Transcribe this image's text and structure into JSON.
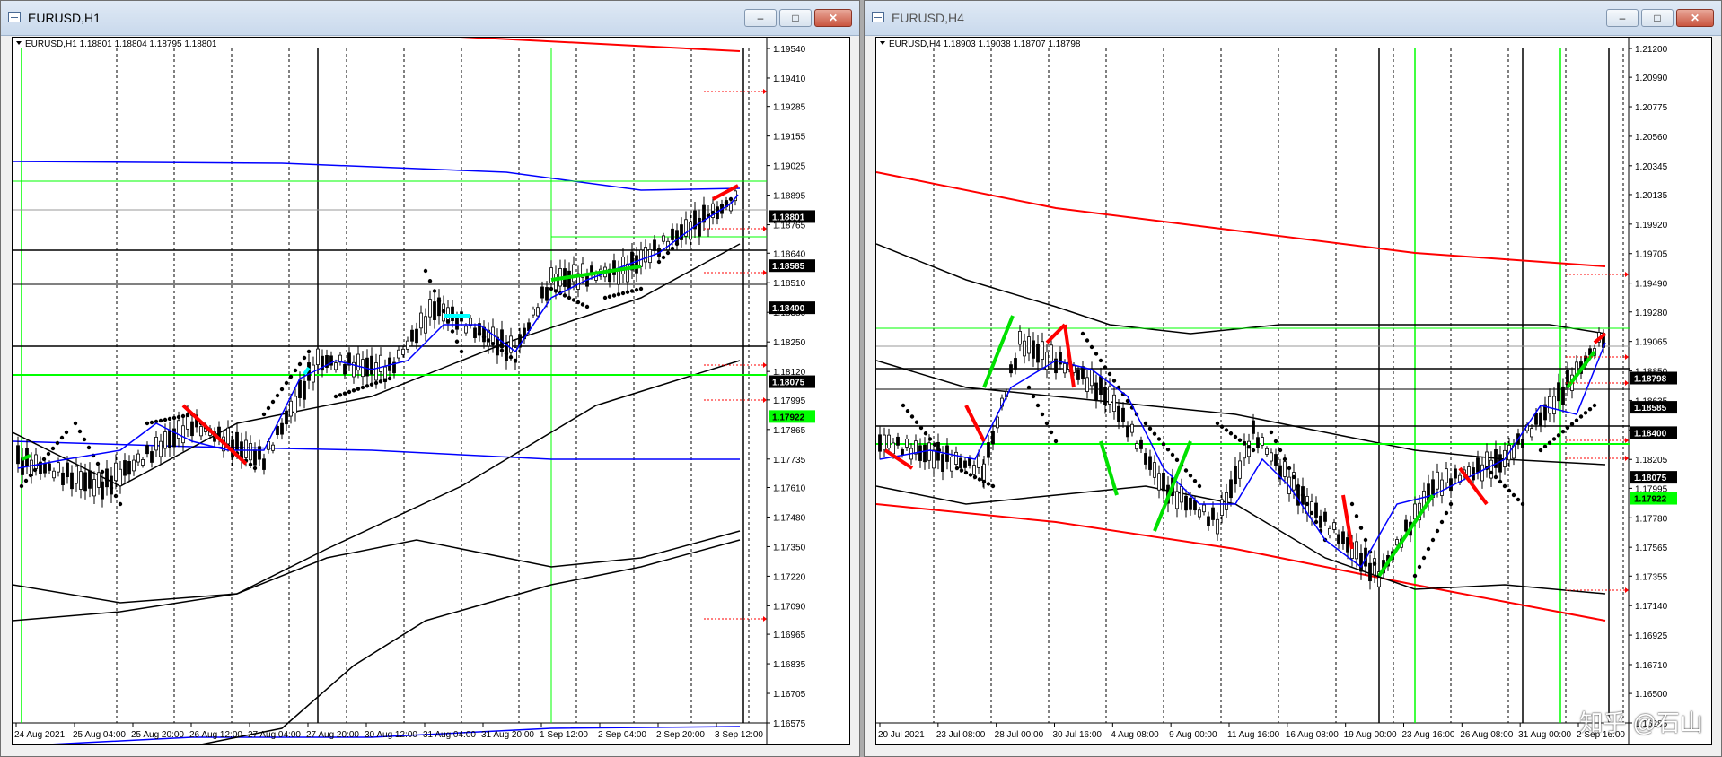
{
  "windows": [
    {
      "title": "EURUSD,H1",
      "header": "EURUSD,H1  1.18801 1.18804 1.18795 1.18801",
      "axis_ticks": [
        "1.19540",
        "1.19410",
        "1.19285",
        "1.19155",
        "1.19025",
        "1.18895",
        "1.18765",
        "1.18640",
        "1.18510",
        "1.18380",
        "1.18250",
        "1.18120",
        "1.17995",
        "1.17865",
        "1.17735",
        "1.17610",
        "1.17480",
        "1.17350",
        "1.17220",
        "1.17090",
        "1.16965",
        "1.16835",
        "1.16705",
        "1.16575"
      ],
      "price_max": 1.1954,
      "price_min": 1.16575,
      "level_labels": [
        {
          "text": "1.18801",
          "color": "#ffffff",
          "bg": "#000000"
        },
        {
          "text": "1.18585",
          "color": "#ffffff",
          "bg": "#000000"
        },
        {
          "text": "1.18400",
          "color": "#ffffff",
          "bg": "#000000"
        },
        {
          "text": "1.18075",
          "color": "#ffffff",
          "bg": "#000000"
        },
        {
          "text": "1.17922",
          "color": "#000000",
          "bg": "#00ff00"
        }
      ],
      "time_labels": [
        "24 Aug 2021",
        "25 Aug 04:00",
        "25 Aug 20:00",
        "26 Aug 12:00",
        "27 Aug 04:00",
        "27 Aug 20:00",
        "30 Aug 12:00",
        "31 Aug 04:00",
        "31 Aug 20:00",
        "1 Sep 12:00",
        "2 Sep 04:00",
        "2 Sep 20:00",
        "3 Sep 12:00"
      ]
    },
    {
      "title": "EURUSD,H4",
      "header": "EURUSD,H4  1.18903 1.19038 1.18707 1.18798",
      "axis_ticks": [
        "1.21200",
        "1.20990",
        "1.20775",
        "1.20560",
        "1.20345",
        "1.20135",
        "1.19920",
        "1.19705",
        "1.19490",
        "1.19280",
        "1.19065",
        "1.18850",
        "1.18635",
        "1.18420",
        "1.18205",
        "1.17995",
        "1.17780",
        "1.17565",
        "1.17355",
        "1.17140",
        "1.16925",
        "1.16710",
        "1.16500",
        "1.16285"
      ],
      "price_max": 1.212,
      "price_min": 1.16285,
      "level_labels": [
        {
          "text": "1.18798",
          "color": "#ffffff",
          "bg": "#000000"
        },
        {
          "text": "1.18585",
          "color": "#ffffff",
          "bg": "#000000"
        },
        {
          "text": "1.18400",
          "color": "#ffffff",
          "bg": "#000000"
        },
        {
          "text": "1.18075",
          "color": "#ffffff",
          "bg": "#000000"
        },
        {
          "text": "1.17922",
          "color": "#000000",
          "bg": "#00ff00"
        }
      ],
      "time_labels": [
        "20 Jul 2021",
        "23 Jul 08:00",
        "28 Jul 00:00",
        "30 Jul 16:00",
        "4 Aug 08:00",
        "9 Aug 00:00",
        "11 Aug 16:00",
        "16 Aug 08:00",
        "19 Aug 00:00",
        "23 Aug 16:00",
        "26 Aug 08:00",
        "31 Aug 00:00",
        "2 Sep 16:00"
      ]
    }
  ],
  "buttons": {
    "minimize": "–",
    "maximize": "□",
    "close": "✕"
  },
  "watermark": "知乎 @石山",
  "colors": {
    "bull": "#00e000",
    "bear": "#ff0000",
    "ma": "#0000ff",
    "band": "#000000",
    "channel": "#ff0000",
    "sar": "#000000"
  }
}
